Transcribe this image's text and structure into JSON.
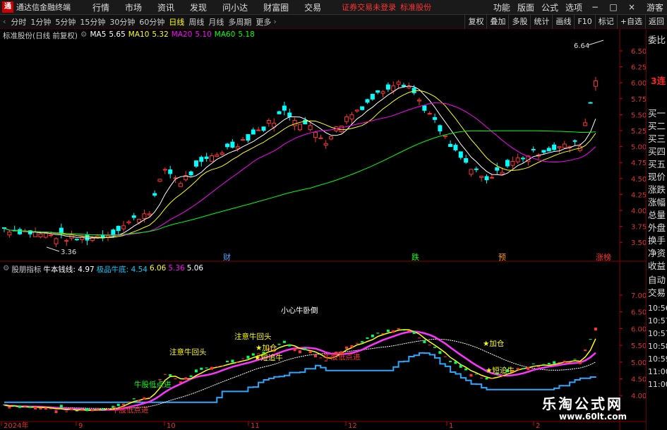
{
  "titlebar": {
    "app_name": "通达信金融终端",
    "menus": [
      "行情",
      "市场",
      "资讯",
      "发现",
      "问小达",
      "财富圈",
      "交易"
    ],
    "login_warning": "证券交易未登录",
    "stock_name": "标准股份",
    "right_items": [
      "功能",
      "版面",
      "公式",
      "选项"
    ],
    "guest": "游客",
    "win_buttons": [
      "−",
      "□",
      "×"
    ]
  },
  "toolbar": {
    "periods": [
      "分时",
      "1分钟",
      "5分钟",
      "15分钟",
      "30分钟",
      "60分钟",
      "日线",
      "周线",
      "月线",
      "多周期",
      "更多"
    ],
    "active_period": "日线",
    "tools": [
      "复权",
      "叠加",
      "多股",
      "统计",
      "画线",
      "F10",
      "标记",
      "+自选",
      "返回"
    ]
  },
  "main_chart": {
    "stock_label": "标准股份(日线 前复权)",
    "ma": [
      {
        "name": "MA5",
        "value": "5.65",
        "color": "#ffffff"
      },
      {
        "name": "MA10",
        "value": "5.32",
        "color": "#ffff00"
      },
      {
        "name": "MA20",
        "value": "5.10",
        "color": "#ff00ff"
      },
      {
        "name": "MA60",
        "value": "5.18",
        "color": "#00ff00"
      }
    ],
    "y_ticks": [
      "6.50",
      "6.25",
      "6.00",
      "5.75",
      "5.50",
      "5.25",
      "5.00",
      "4.75",
      "4.50",
      "4.25",
      "4.00",
      "3.75",
      "3.50"
    ],
    "high_label": "6.64",
    "low_label": "3.36",
    "events": [
      {
        "text": "财",
        "color": "#4da6ff"
      },
      {
        "text": "跌",
        "color": "#00ff00"
      },
      {
        "text": "预",
        "color": "#ff9900"
      },
      {
        "text": "涨榜",
        "color": "#ff3333"
      }
    ]
  },
  "indicator": {
    "name": "股朋指标",
    "line_label": "牛本钱线: 4.97",
    "bottom_label": "极品牛底: 4.54",
    "v1": "6.06",
    "v2": "5.36",
    "v3": "5.06",
    "y_ticks": [
      "7.00",
      "6.50",
      "6.00",
      "5.50",
      "5.00",
      "4.50",
      "4.00"
    ],
    "annotations": [
      {
        "text": "小心牛卧倒",
        "color": "#ffffff"
      },
      {
        "text": "注意牛回头",
        "color": "#ffff00"
      },
      {
        "text": "注意牛回头",
        "color": "#ffff00"
      },
      {
        "text": "★加仓",
        "color": "#ffff00"
      },
      {
        "text": "★短追牛",
        "color": "#ffff00"
      },
      {
        "text": "牛股低点进",
        "color": "#ff3333"
      },
      {
        "text": "牛股低点进",
        "color": "#00ff00"
      },
      {
        "text": "牛股低点进",
        "color": "#ff3333"
      },
      {
        "text": "★加仓",
        "color": "#ffff00"
      },
      {
        "text": "★短追牛",
        "color": "#ffff00"
      }
    ]
  },
  "x_axis": [
    "2024年",
    "9",
    "10",
    "11",
    "12",
    "1",
    "2"
  ],
  "right_panel": {
    "top": "委比",
    "streak": "3连",
    "items": [
      "买一",
      "买二",
      "买三",
      "买四",
      "买五",
      "现价",
      "涨跌",
      "涨幅",
      "总量",
      "外盘",
      "换手",
      "净资",
      "收益",
      "自动",
      "交易"
    ],
    "times": [
      "10:56",
      "10:57",
      "10:57",
      "10:58",
      "10:59",
      "11:00",
      "11:00"
    ]
  },
  "watermark": {
    "cn": "乐淘公式网",
    "url": "www.60lt.com"
  }
}
